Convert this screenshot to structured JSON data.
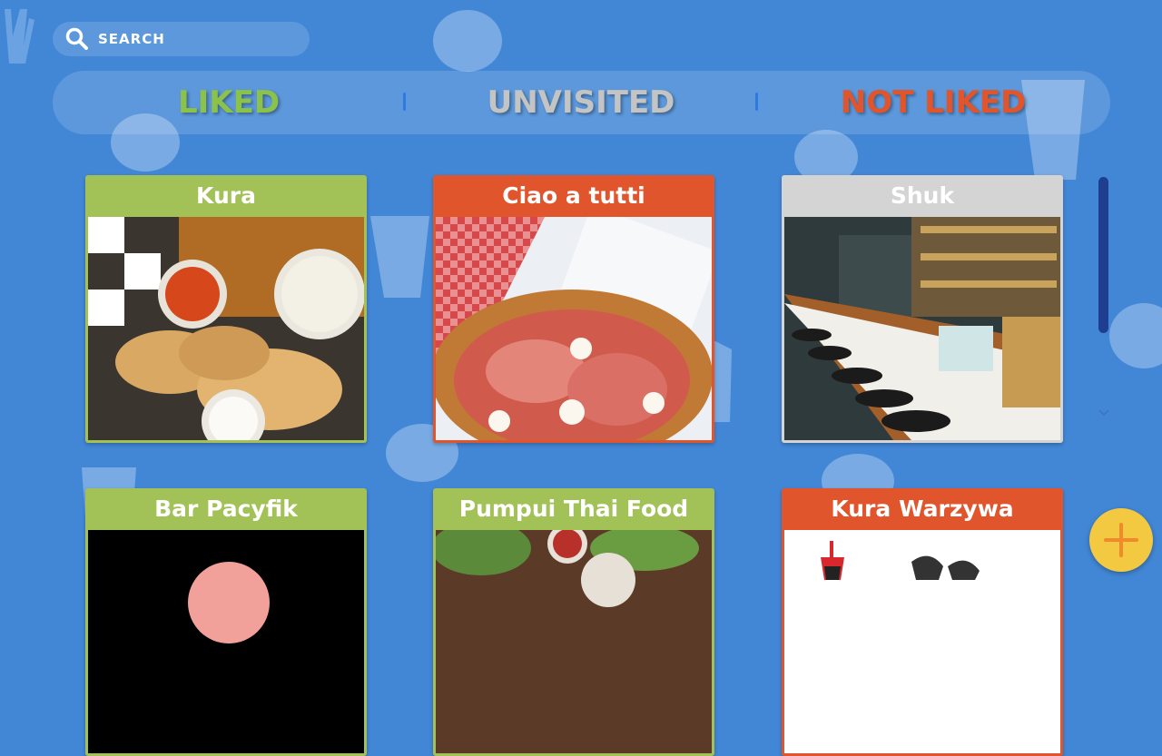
{
  "search": {
    "placeholder": "SEARCH",
    "icon": "search-icon"
  },
  "tabs": [
    {
      "label": "LIKED",
      "color": "#8bc34a"
    },
    {
      "label": "UNVISITED",
      "color": "#c4c4c4"
    },
    {
      "label": "NOT LIKED",
      "color": "#e0552b"
    }
  ],
  "status_colors": {
    "liked": "#a2c157",
    "not_liked": "#e1552d",
    "unvisited": "#d4d4d4"
  },
  "restaurants": [
    {
      "name": "Kura",
      "status": "liked"
    },
    {
      "name": "Ciao a tutti",
      "status": "not_liked"
    },
    {
      "name": "Shuk",
      "status": "unvisited"
    },
    {
      "name": "Bar Pacyfik",
      "status": "liked"
    },
    {
      "name": "Pumpui Thai Food",
      "status": "liked"
    },
    {
      "name": "Kura Warzywa",
      "status": "not_liked"
    }
  ],
  "fab": {
    "icon": "plus-icon"
  },
  "accent": "#f4c942"
}
